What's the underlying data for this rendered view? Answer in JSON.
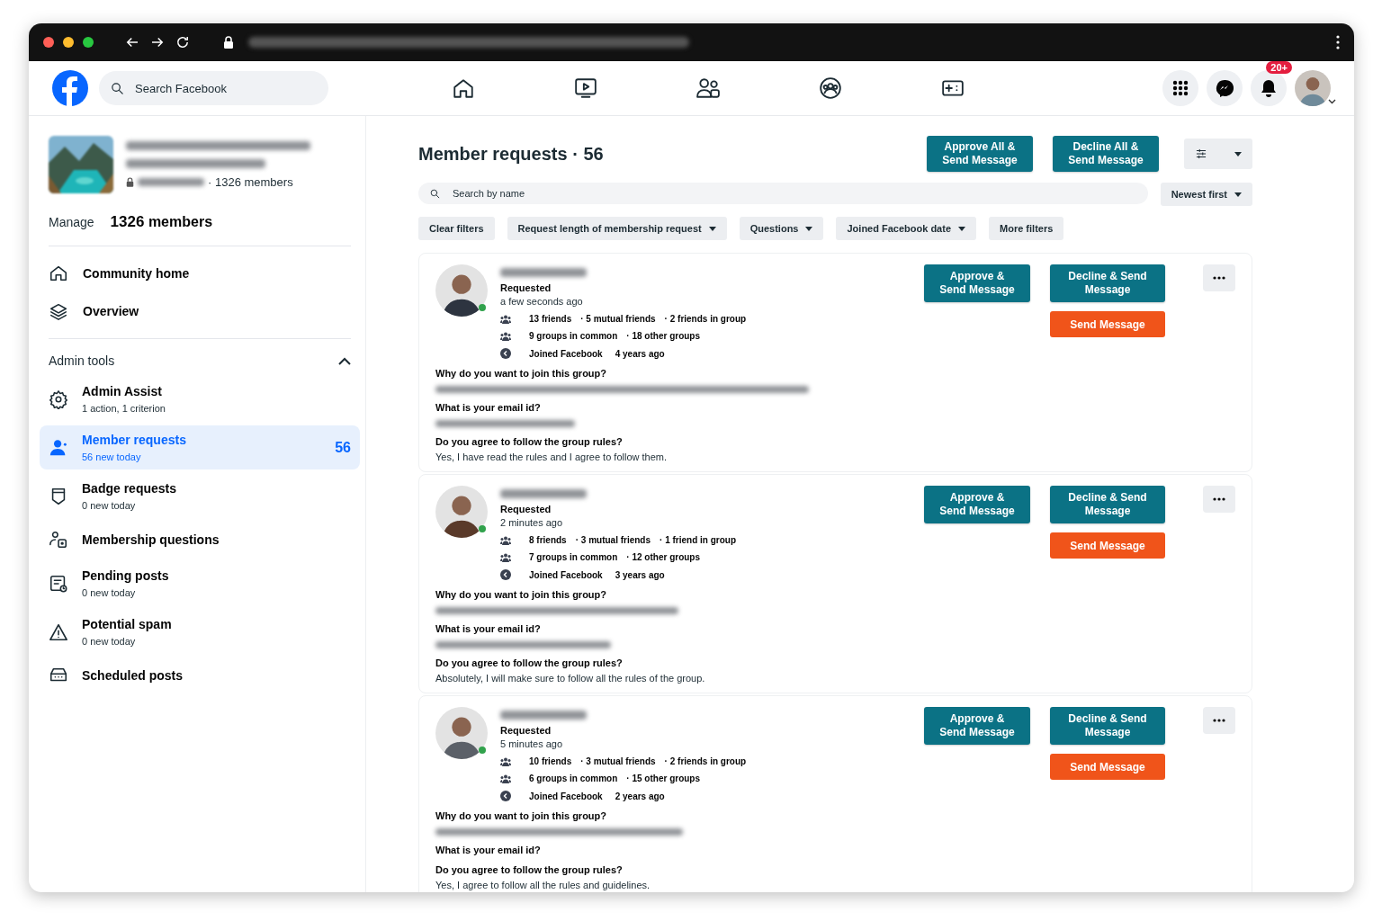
{
  "top_bar": {
    "search": {
      "placeholder": "Search Facebook"
    },
    "notifications_badge": "20+"
  },
  "group": {
    "members_text": "· 1326 members"
  },
  "manage": {
    "label": "Manage",
    "count": "1326",
    "unit": "members"
  },
  "nav_items": [
    {
      "label": "Community home",
      "kind": "home"
    },
    {
      "label": "Overview",
      "kind": "layers"
    }
  ],
  "admin_tools": {
    "title": "Admin tools",
    "expanded": true,
    "items": [
      {
        "label": "Admin Assist",
        "sub": "1 action, 1 criterion",
        "kind": "gear",
        "selected": false
      },
      {
        "label": "Member requests",
        "sub": "56 new today",
        "count": "56",
        "kind": "person",
        "selected": true
      },
      {
        "label": "Badge requests",
        "sub": "0 new today",
        "kind": "badge",
        "selected": false
      },
      {
        "label": "Membership questions",
        "kind": "questions",
        "selected": false
      },
      {
        "label": "Pending posts",
        "sub": "0 new today",
        "kind": "pending",
        "selected": false
      },
      {
        "label": "Potential spam",
        "sub": "0 new today",
        "kind": "warning",
        "selected": false
      },
      {
        "label": "Scheduled posts",
        "kind": "scheduled",
        "selected": false
      }
    ]
  },
  "page": {
    "title": "Member requests · 56",
    "bulk_buttons": [
      "Approve All & Send Message",
      "Decline All & Send Message"
    ],
    "member_search": {
      "placeholder": "Search by name"
    },
    "sort": "Newest first",
    "filters": [
      {
        "label": "Clear filters",
        "dropdown": false
      },
      {
        "label": "Request length of membership request",
        "dropdown": true
      },
      {
        "label": "Questions",
        "dropdown": true
      },
      {
        "label": "Joined Facebook date",
        "dropdown": true
      },
      {
        "label": "More filters",
        "dropdown": false
      }
    ]
  },
  "requests": [
    {
      "status": "Requested",
      "time": "a few seconds ago",
      "online": true,
      "friends": [
        "13 friends",
        "· 5 mutual friends",
        "· 2 friends in group"
      ],
      "groups": [
        "9 groups in common",
        "· 18 other groups"
      ],
      "joined": [
        "Joined Facebook",
        "4 years ago"
      ],
      "questions": [
        {
          "question": "Why do you want to join this group?",
          "answer_blurred": true
        },
        {
          "question": "What is your email id?",
          "answer_blurred": true
        },
        {
          "question": "Do you agree to follow the group rules?",
          "answer": "Yes, I have read the rules and I agree to follow them.",
          "answer_blurred": false
        }
      ],
      "actions": [
        "Approve & Send Message",
        "Decline & Send Message",
        "Send Message"
      ]
    },
    {
      "status": "Requested",
      "time": "2 minutes ago",
      "online": true,
      "friends": [
        "8 friends",
        "· 3 mutual friends",
        "· 1 friend in group"
      ],
      "groups": [
        "7 groups in common",
        "· 12 other groups"
      ],
      "joined": [
        "Joined Facebook",
        "3 years ago"
      ],
      "questions": [
        {
          "question": "Why do you want to join this group?",
          "answer_blurred": true
        },
        {
          "question": "What is your email id?",
          "answer_blurred": true
        },
        {
          "question": "Do you agree to follow the group rules?",
          "answer": "Absolutely, I will make sure to follow all the rules of the group.",
          "answer_blurred": false
        }
      ],
      "actions": [
        "Approve & Send Message",
        "Decline & Send Message",
        "Send Message"
      ]
    },
    {
      "status": "Requested",
      "time": "5 minutes ago",
      "online": true,
      "friends": [
        "10 friends",
        "· 3 mutual friends",
        "· 2 friends in group"
      ],
      "groups": [
        "6 groups in common",
        "· 15 other groups"
      ],
      "joined": [
        "Joined Facebook",
        "2 years ago"
      ],
      "questions": [
        {
          "question": "Why do you want to join this group?",
          "answer_blurred": true
        },
        {
          "question": "What is your email id?",
          "answer_blurred": false
        },
        {
          "question": "Do you agree to follow the group rules?",
          "answer": "Yes, I agree to follow all the rules and guidelines.",
          "answer_blurred": false
        }
      ],
      "actions": [
        "Approve & Send Message",
        "Decline & Send Message",
        "Send Message"
      ]
    }
  ]
}
